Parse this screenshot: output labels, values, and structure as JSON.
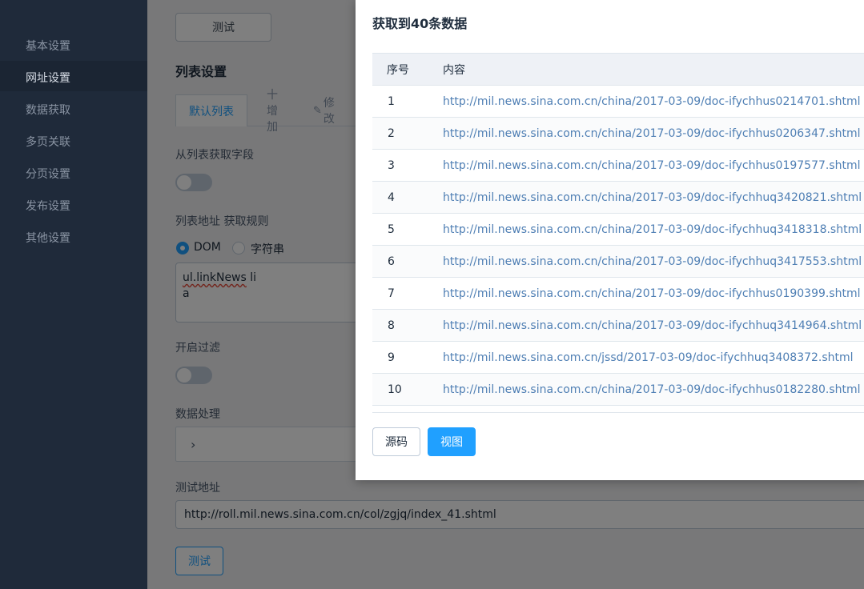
{
  "sidebar": {
    "items": [
      {
        "label": "基本设置"
      },
      {
        "label": "网址设置"
      },
      {
        "label": "数据获取"
      },
      {
        "label": "多页关联"
      },
      {
        "label": "分页设置"
      },
      {
        "label": "发布设置"
      },
      {
        "label": "其他设置"
      }
    ],
    "active_index": 1
  },
  "main": {
    "top_test_button": "测试",
    "list_section_title": "列表设置",
    "tabs": {
      "default_tab": "默认列表",
      "add_tab": "十增加",
      "edit_tab": "修改"
    },
    "extract_fields_label": "从列表获取字段",
    "list_url_rule_label": "列表地址 获取规则",
    "radio_dom_label": "DOM",
    "radio_string_label": "字符串",
    "rule_line1_a": "ul.linkNews",
    "rule_line1_b": " li",
    "rule_line2": "a",
    "filter_label": "开启过滤",
    "data_process_label": "数据处理",
    "test_url_label": "测试地址",
    "test_url_value": "http://roll.mil.news.sina.com.cn/col/zgjq/index_41.shtml",
    "bottom_test_button": "测试"
  },
  "dialog": {
    "title": "获取到40条数据",
    "columns": {
      "index": "序号",
      "content": "内容"
    },
    "rows": [
      {
        "index": "1",
        "content": "http://mil.news.sina.com.cn/china/2017-03-09/doc-ifychhus0214701.shtml"
      },
      {
        "index": "2",
        "content": "http://mil.news.sina.com.cn/china/2017-03-09/doc-ifychhus0206347.shtml"
      },
      {
        "index": "3",
        "content": "http://mil.news.sina.com.cn/china/2017-03-09/doc-ifychhus0197577.shtml"
      },
      {
        "index": "4",
        "content": "http://mil.news.sina.com.cn/china/2017-03-09/doc-ifychhuq3420821.shtml"
      },
      {
        "index": "5",
        "content": "http://mil.news.sina.com.cn/china/2017-03-09/doc-ifychhuq3418318.shtml"
      },
      {
        "index": "6",
        "content": "http://mil.news.sina.com.cn/china/2017-03-09/doc-ifychhuq3417553.shtml"
      },
      {
        "index": "7",
        "content": "http://mil.news.sina.com.cn/china/2017-03-09/doc-ifychhus0190399.shtml"
      },
      {
        "index": "8",
        "content": "http://mil.news.sina.com.cn/china/2017-03-09/doc-ifychhuq3414964.shtml"
      },
      {
        "index": "9",
        "content": "http://mil.news.sina.com.cn/jssd/2017-03-09/doc-ifychhuq3408372.shtml"
      },
      {
        "index": "10",
        "content": "http://mil.news.sina.com.cn/china/2017-03-09/doc-ifychhus0182280.shtml"
      }
    ],
    "source_button": "源码",
    "view_button": "视图"
  },
  "colors": {
    "sidebar_bg": "#1f2a3a",
    "accent": "#20a0ff",
    "link": "#4f7fb4"
  }
}
